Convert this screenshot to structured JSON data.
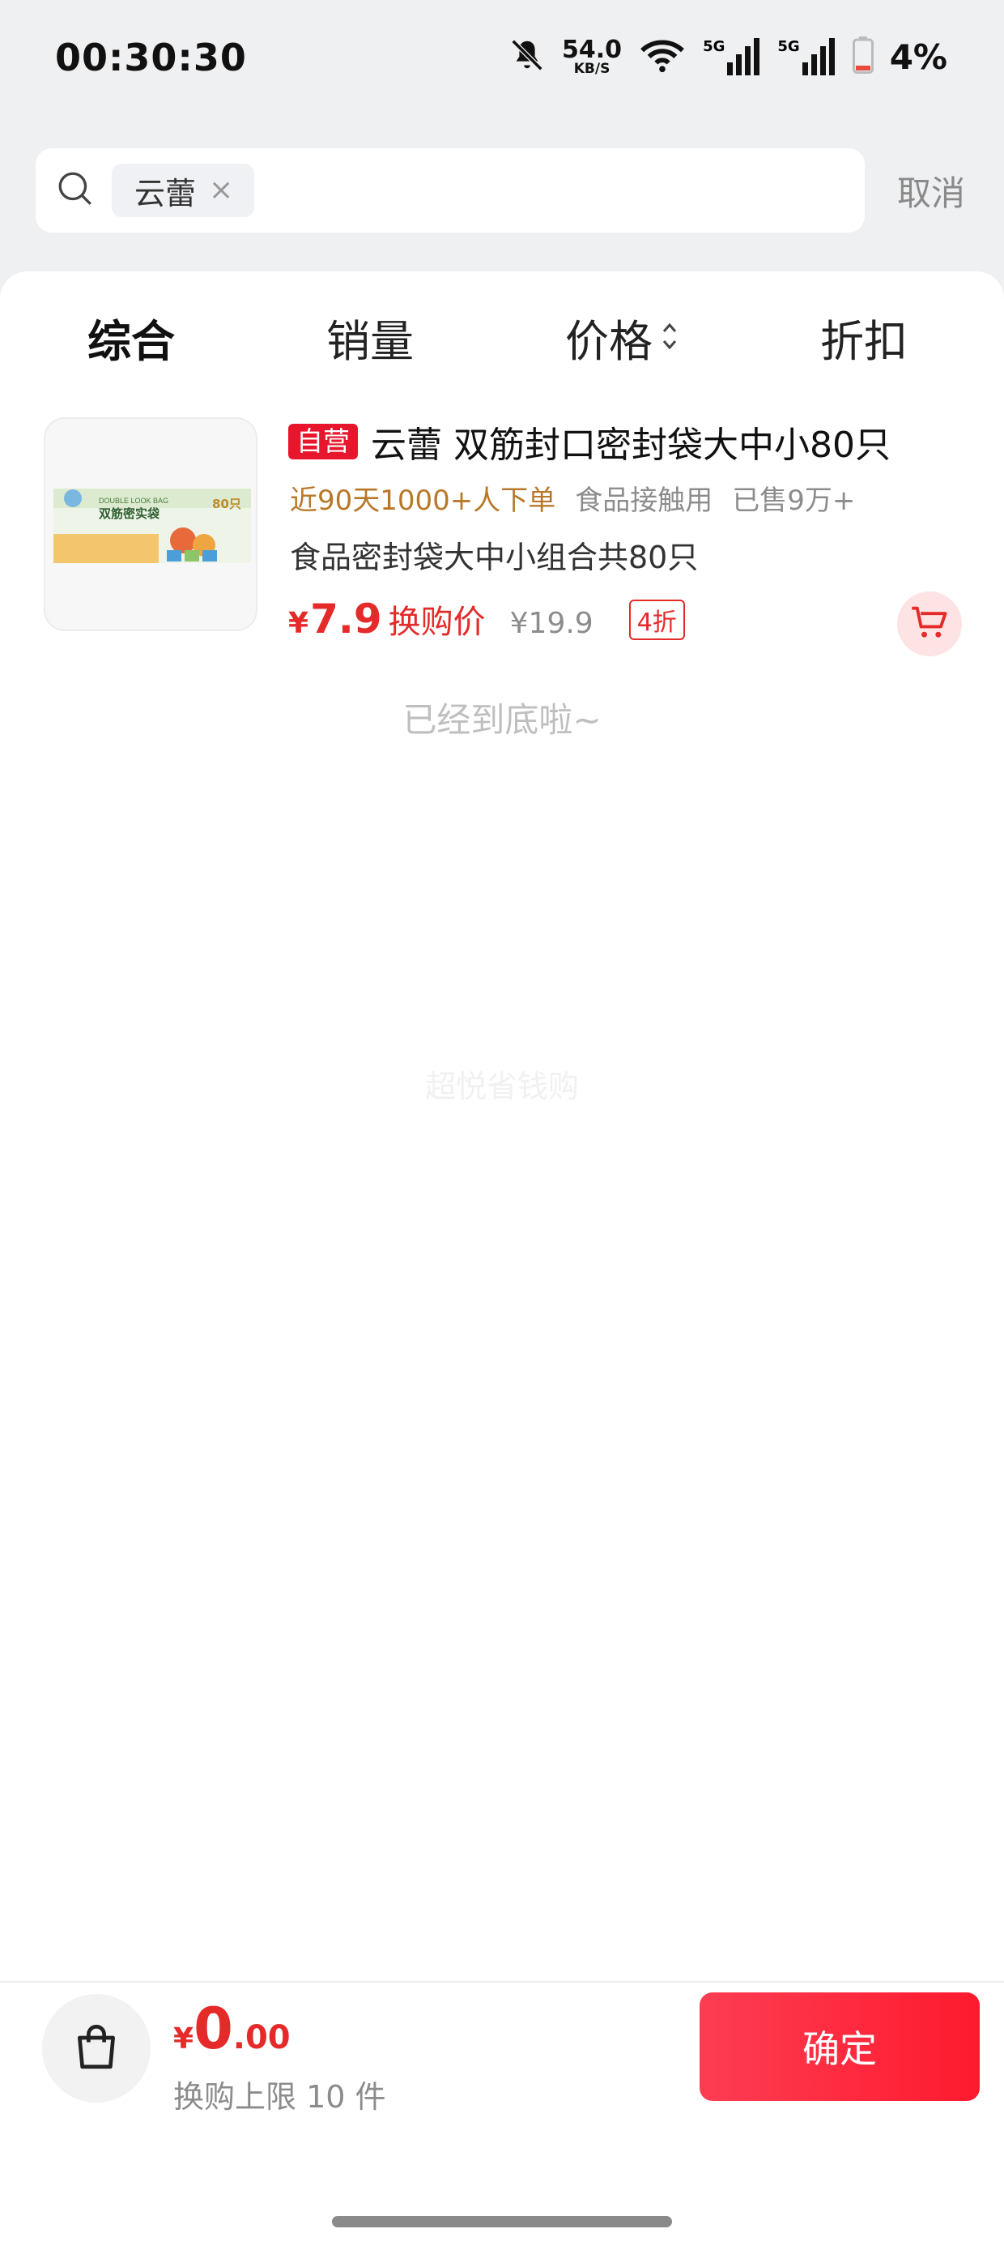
{
  "status_bar": {
    "time": "00:30:30",
    "net_speed_value": "54.0",
    "net_speed_unit": "KB/S",
    "signal_1_label": "5G",
    "signal_2_label": "5G",
    "battery_percent": "4%",
    "battery_color": "#e84a3c"
  },
  "search": {
    "keyword": "云蕾",
    "chip_close": "×",
    "cancel_label": "取消"
  },
  "sort_tabs": [
    {
      "label": "综合",
      "active": true
    },
    {
      "label": "销量",
      "active": false
    },
    {
      "label": "价格",
      "active": false
    },
    {
      "label": "折扣",
      "active": false
    }
  ],
  "product": {
    "badge": "自营",
    "title": "云蕾 双筋封口密封袋大中小80只",
    "orders_hint": "近90天1000+人下单",
    "tag": "食品接触用",
    "sold": "已售9万+",
    "description": "食品密封袋大中小组合共80只",
    "price_currency": "¥",
    "price_value": "7.9",
    "price_label": "换购价",
    "original_price": "¥19.9",
    "discount": "4折",
    "thumb_en_text": "DOUBLE LOOK BAG",
    "thumb_cn_text": "双筋密实袋",
    "thumb_count_text": "80只"
  },
  "end_hint": "已经到底啦~",
  "watermark": "超悦省钱购",
  "bottom_bar": {
    "total_currency": "¥",
    "total_int": "0",
    "total_dec": ".00",
    "limit_text": "换购上限 10 件",
    "confirm_label": "确定"
  },
  "colors": {
    "accent_red": "#e52a2a",
    "badge_red": "#e8162d",
    "orders_brown": "#b8782a",
    "confirm_gradient_start": "#fd3d53",
    "confirm_gradient_end": "#fe1a2e"
  }
}
